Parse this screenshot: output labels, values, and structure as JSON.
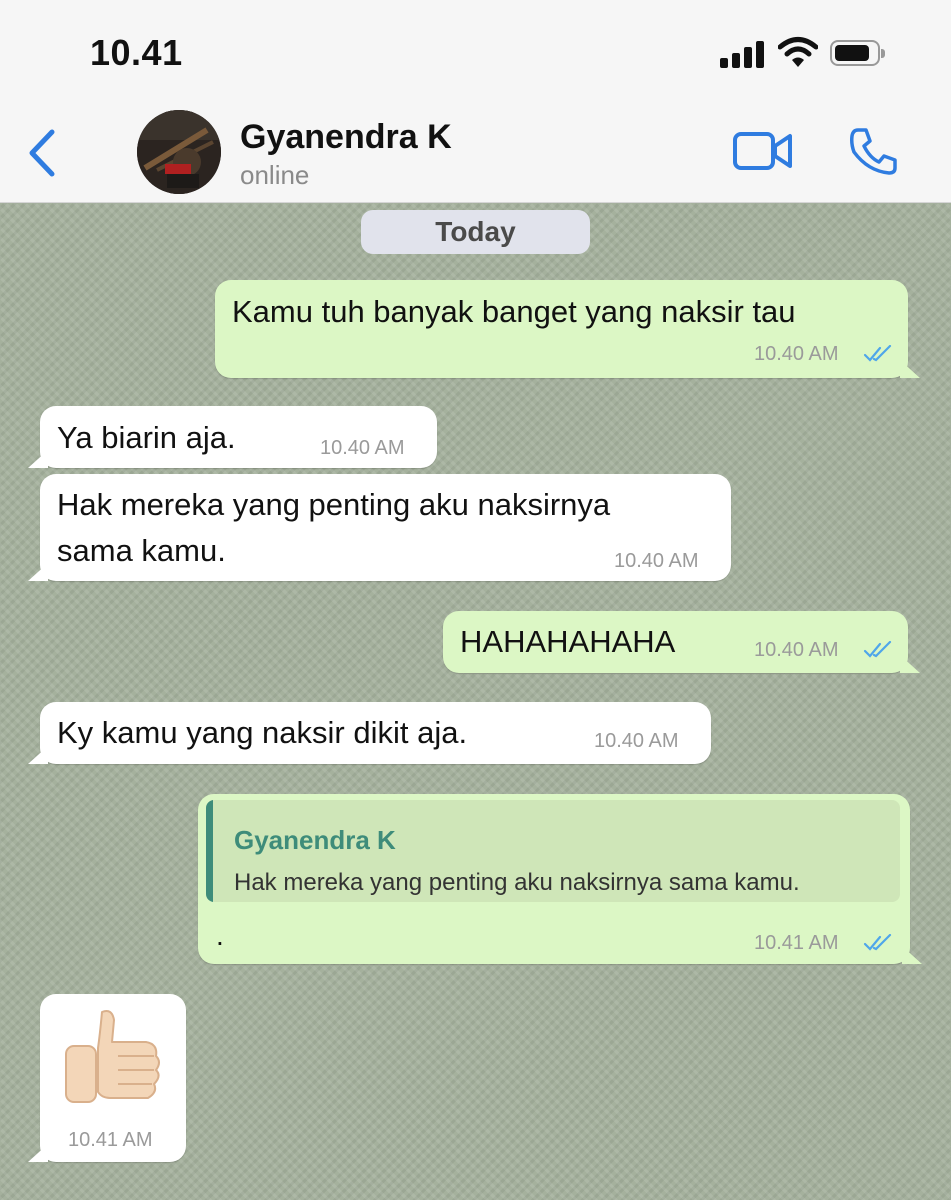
{
  "status_bar": {
    "time": "10.41"
  },
  "header": {
    "contact_name": "Gyanendra K",
    "contact_status": "online"
  },
  "chat": {
    "date_label": "Today",
    "messages": [
      {
        "direction": "out",
        "text": "Kamu tuh banyak banget yang naksir tau",
        "time": "10.40 AM",
        "status": "read"
      },
      {
        "direction": "in",
        "text": "Ya biarin aja.",
        "time": "10.40 AM"
      },
      {
        "direction": "in",
        "line1": "Hak mereka yang penting aku naksirnya",
        "line2": "sama kamu.",
        "time": "10.40 AM"
      },
      {
        "direction": "out",
        "text": "HAHAHAHAHA",
        "time": "10.40 AM",
        "status": "read"
      },
      {
        "direction": "in",
        "text": "Ky kamu yang naksir dikit aja.",
        "time": "10.40 AM"
      },
      {
        "direction": "out",
        "quote_author": "Gyanendra K",
        "quote_text": "Hak mereka yang penting aku naksirnya sama kamu.",
        "text": ".",
        "time": "10.41 AM",
        "status": "read"
      },
      {
        "direction": "in",
        "emoji": "thumbs-up",
        "time": "10.41 AM"
      }
    ]
  },
  "colors": {
    "accent": "#2f7ce0",
    "outgoing_bubble": "#dcf7c5",
    "incoming_bubble": "#ffffff",
    "read_ticks": "#4fa6ea",
    "quote_accent": "#3e8c7a",
    "chat_background": "#a5b19d"
  }
}
